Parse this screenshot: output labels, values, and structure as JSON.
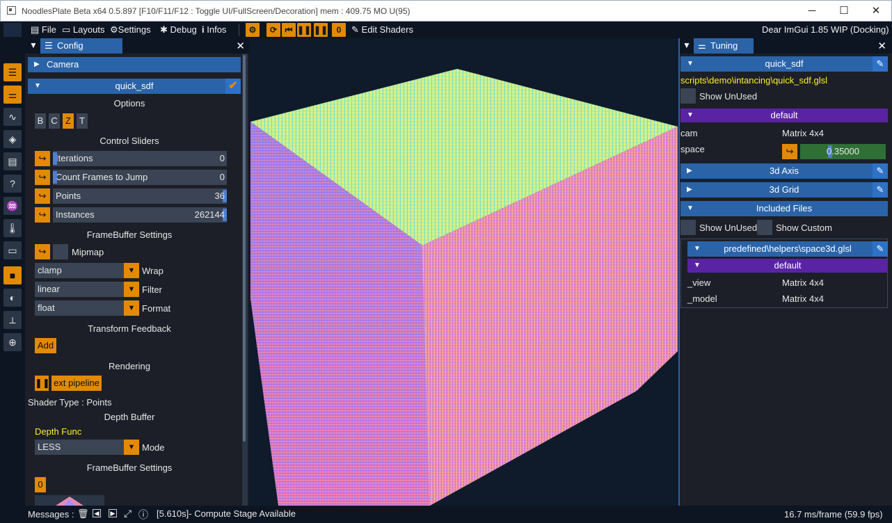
{
  "window": {
    "title": "NoodlesPlate Beta x64 0.5.897 [F10/F11/F12 : Toggle UI/FullScreen/Decoration] mem : 409.75 MO U(95)",
    "minimize": "─",
    "maximize": "☐",
    "close": "✕"
  },
  "menu": {
    "file": "File",
    "layouts": "Layouts",
    "settings": "Settings",
    "debug": "Debug",
    "infos": "Infos",
    "counter": "0",
    "edit_shaders": "Edit Shaders",
    "imgui_version": "Dear ImGui 1.85 WIP (Docking)"
  },
  "config": {
    "tab": "Config",
    "camera": "Camera",
    "shader_name": "quick_sdf",
    "options_title": "Options",
    "option_buttons": [
      "B",
      "C",
      "Z",
      "T"
    ],
    "active_option": "Z",
    "control_sliders_title": "Control Sliders",
    "sliders": [
      {
        "label": "Iterations",
        "value": "0",
        "fraction": 0.0
      },
      {
        "label": "Count Frames to Jump",
        "value": "0",
        "fraction": 0.0
      },
      {
        "label": "Points",
        "value": "36",
        "fraction": 1.0
      },
      {
        "label": "Instances",
        "value": "262144",
        "fraction": 1.0
      }
    ],
    "framebuffer_settings_title": "FrameBuffer Settings",
    "mipmap_label": "Mipmap",
    "combos": [
      {
        "value": "clamp",
        "label": "Wrap"
      },
      {
        "value": "linear",
        "label": "Filter"
      },
      {
        "value": "float",
        "label": "Format"
      }
    ],
    "transform_feedback_title": "Transform Feedback",
    "add_button": "Add",
    "rendering_title": "Rendering",
    "pipeline_button": "ext pipeline",
    "shader_type": "Shader Type : Points",
    "depth_buffer_title": "Depth Buffer",
    "depth_func_label": "Depth Func",
    "depth_mode": {
      "value": "LESS",
      "label": "Mode"
    },
    "framebuffer_settings_title2": "FrameBuffer Settings",
    "fb_index": "0"
  },
  "tuning": {
    "tab": "Tuning",
    "shader_name": "quick_sdf",
    "script_path": "scripts\\demo\\intancing\\quick_sdf.glsl",
    "show_unused": "Show UnUsed",
    "default_section": "default",
    "uniforms": [
      {
        "name": "cam",
        "value": "Matrix 4x4"
      },
      {
        "name": "space",
        "value": "0.35000"
      }
    ],
    "sections": [
      "3d Axis",
      "3d Grid",
      "Included Files"
    ],
    "show_unused2": "Show UnUsed",
    "show_custom": "Show Custom",
    "include_file": "predefined\\helpers\\space3d.glsl",
    "default_section2": "default",
    "include_uniforms": [
      {
        "name": "_view",
        "value": "Matrix 4x4"
      },
      {
        "name": "_model",
        "value": "Matrix 4x4"
      }
    ]
  },
  "status": {
    "messages_label": "Messages :",
    "message": "[5.610s]- Compute Stage Available",
    "fps": "16.7 ms/frame (59.9 fps)"
  },
  "icons": {
    "file": "file-icon",
    "layouts": "monitor-icon",
    "settings": "gear-icon",
    "debug": "bug-icon",
    "infos": "info-icon"
  },
  "colors": {
    "accent_orange": "#e38a05",
    "header_blue": "#2a63a8",
    "section_purple": "#5a23a4",
    "path_yellow": "#ffef30",
    "panel_bg": "#1c1f27"
  }
}
